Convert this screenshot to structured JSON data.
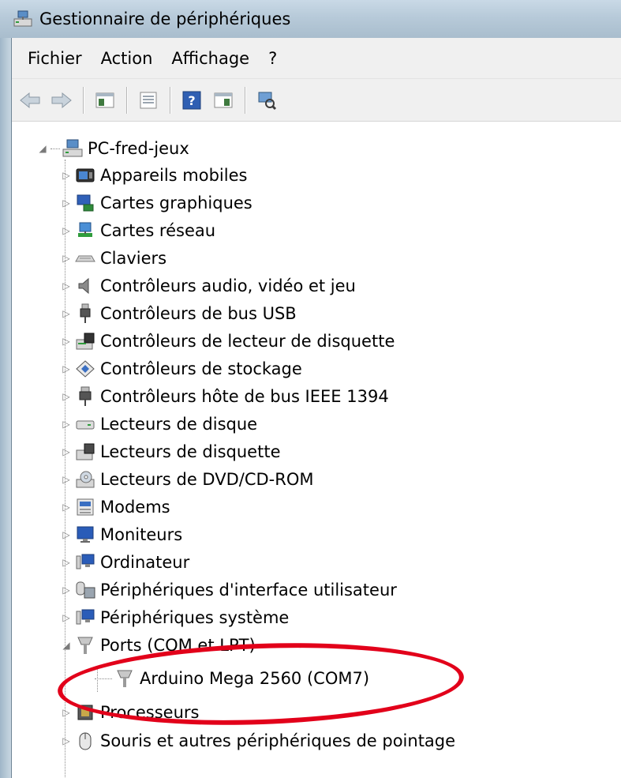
{
  "window": {
    "title": "Gestionnaire de périphériques",
    "icon": "device-manager-icon"
  },
  "menu": {
    "items": [
      {
        "label": "Fichier"
      },
      {
        "label": "Action"
      },
      {
        "label": "Affichage"
      },
      {
        "label": "?"
      }
    ]
  },
  "toolbar": {
    "buttons": [
      {
        "icon": "back-arrow-icon"
      },
      {
        "icon": "forward-arrow-icon"
      },
      {
        "icon": "console-tree-icon"
      },
      {
        "icon": "properties-icon"
      },
      {
        "icon": "help-icon"
      },
      {
        "icon": "action-pane-icon"
      },
      {
        "icon": "scan-hardware-icon"
      }
    ]
  },
  "tree": {
    "root": {
      "label": "PC-fred-jeux",
      "expanded": true,
      "icon": "computer-icon"
    },
    "items": [
      {
        "label": "Appareils mobiles",
        "icon": "mobile-device-icon"
      },
      {
        "label": "Cartes graphiques",
        "icon": "display-adapter-icon"
      },
      {
        "label": "Cartes réseau",
        "icon": "network-adapter-icon"
      },
      {
        "label": "Claviers",
        "icon": "keyboard-icon"
      },
      {
        "label": "Contrôleurs audio, vidéo et jeu",
        "icon": "speaker-icon"
      },
      {
        "label": "Contrôleurs de bus USB",
        "icon": "usb-icon"
      },
      {
        "label": "Contrôleurs de lecteur de disquette",
        "icon": "floppy-controller-icon"
      },
      {
        "label": "Contrôleurs de stockage",
        "icon": "storage-controller-icon"
      },
      {
        "label": "Contrôleurs hôte de bus IEEE 1394",
        "icon": "ieee1394-icon"
      },
      {
        "label": "Lecteurs de disque",
        "icon": "disk-drive-icon"
      },
      {
        "label": "Lecteurs de disquette",
        "icon": "floppy-drive-icon"
      },
      {
        "label": "Lecteurs de DVD/CD-ROM",
        "icon": "dvd-drive-icon"
      },
      {
        "label": "Modems",
        "icon": "modem-icon"
      },
      {
        "label": "Moniteurs",
        "icon": "monitor-icon"
      },
      {
        "label": "Ordinateur",
        "icon": "computer-icon"
      },
      {
        "label": "Périphériques d'interface utilisateur",
        "icon": "hid-icon"
      },
      {
        "label": "Périphériques système",
        "icon": "system-device-icon"
      },
      {
        "label": "Ports (COM et LPT)",
        "icon": "port-icon",
        "expanded": true
      },
      {
        "label": "Arduino Mega 2560 (COM7)",
        "icon": "port-icon",
        "child": true
      },
      {
        "label": "Processeurs",
        "icon": "processor-icon"
      },
      {
        "label": "Souris et autres périphériques de pointage",
        "icon": "mouse-icon"
      }
    ]
  },
  "annotation": {
    "color": "#e2001a"
  }
}
